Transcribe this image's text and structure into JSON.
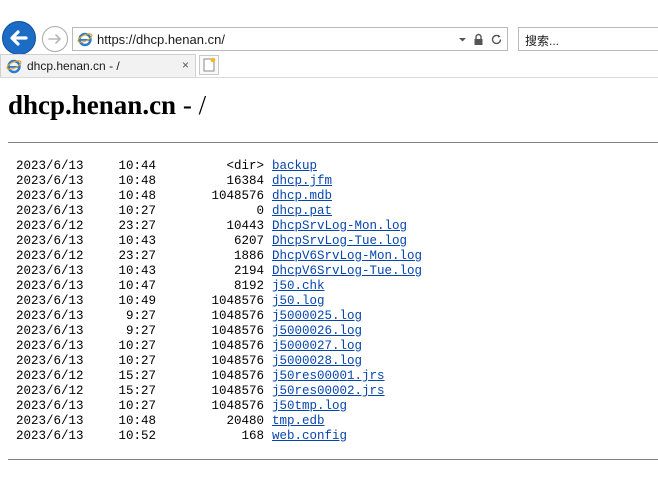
{
  "browser": {
    "url": "https://dhcp.henan.cn/",
    "search_placeholder": "搜索...",
    "tab_title": "dhcp.henan.cn - /",
    "tab_close": "×"
  },
  "page": {
    "title_host": "dhcp.henan.cn",
    "title_sep": " - /"
  },
  "listing": [
    {
      "date": "2023/6/13",
      "time": "10:44",
      "size": "<dir>",
      "name": "backup"
    },
    {
      "date": "2023/6/13",
      "time": "10:48",
      "size": "16384",
      "name": "dhcp.jfm"
    },
    {
      "date": "2023/6/13",
      "time": "10:48",
      "size": "1048576",
      "name": "dhcp.mdb"
    },
    {
      "date": "2023/6/13",
      "time": "10:27",
      "size": "0",
      "name": "dhcp.pat"
    },
    {
      "date": "2023/6/12",
      "time": "23:27",
      "size": "10443",
      "name": "DhcpSrvLog-Mon.log"
    },
    {
      "date": "2023/6/13",
      "time": "10:43",
      "size": "6207",
      "name": "DhcpSrvLog-Tue.log"
    },
    {
      "date": "2023/6/12",
      "time": "23:27",
      "size": "1886",
      "name": "DhcpV6SrvLog-Mon.log"
    },
    {
      "date": "2023/6/13",
      "time": "10:43",
      "size": "2194",
      "name": "DhcpV6SrvLog-Tue.log"
    },
    {
      "date": "2023/6/13",
      "time": "10:47",
      "size": "8192",
      "name": "j50.chk"
    },
    {
      "date": "2023/6/13",
      "time": "10:49",
      "size": "1048576",
      "name": "j50.log"
    },
    {
      "date": "2023/6/13",
      "time": "9:27",
      "size": "1048576",
      "name": "j5000025.log"
    },
    {
      "date": "2023/6/13",
      "time": "9:27",
      "size": "1048576",
      "name": "j5000026.log"
    },
    {
      "date": "2023/6/13",
      "time": "10:27",
      "size": "1048576",
      "name": "j5000027.log"
    },
    {
      "date": "2023/6/13",
      "time": "10:27",
      "size": "1048576",
      "name": "j5000028.log"
    },
    {
      "date": "2023/6/12",
      "time": "15:27",
      "size": "1048576",
      "name": "j50res00001.jrs"
    },
    {
      "date": "2023/6/12",
      "time": "15:27",
      "size": "1048576",
      "name": "j50res00002.jrs"
    },
    {
      "date": "2023/6/13",
      "time": "10:27",
      "size": "1048576",
      "name": "j50tmp.log"
    },
    {
      "date": "2023/6/13",
      "time": "10:48",
      "size": "20480",
      "name": "tmp.edb"
    },
    {
      "date": "2023/6/13",
      "time": "10:52",
      "size": "168",
      "name": "web.config"
    }
  ]
}
